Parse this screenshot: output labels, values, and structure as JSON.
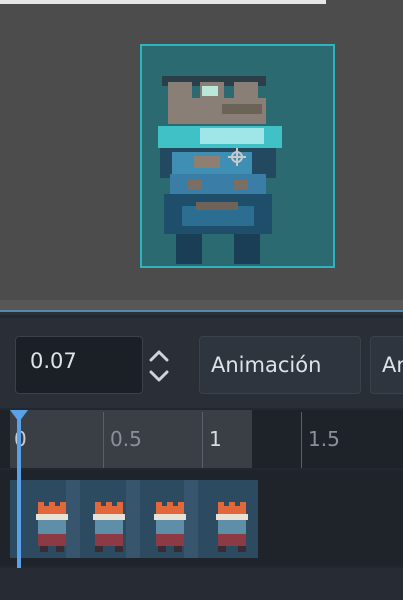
{
  "toolbar": {
    "frame_duration_value": "0.07",
    "animation_button_label": "Animación",
    "cut_button_label": "An"
  },
  "timeline": {
    "ticks": [
      "0",
      "0.5",
      "1",
      "1.5"
    ],
    "frame_count": 4
  },
  "colors": {
    "accent": "#5aa1ea",
    "selection_fill": "#2b6a70",
    "selection_border": "#2fb4bf"
  }
}
